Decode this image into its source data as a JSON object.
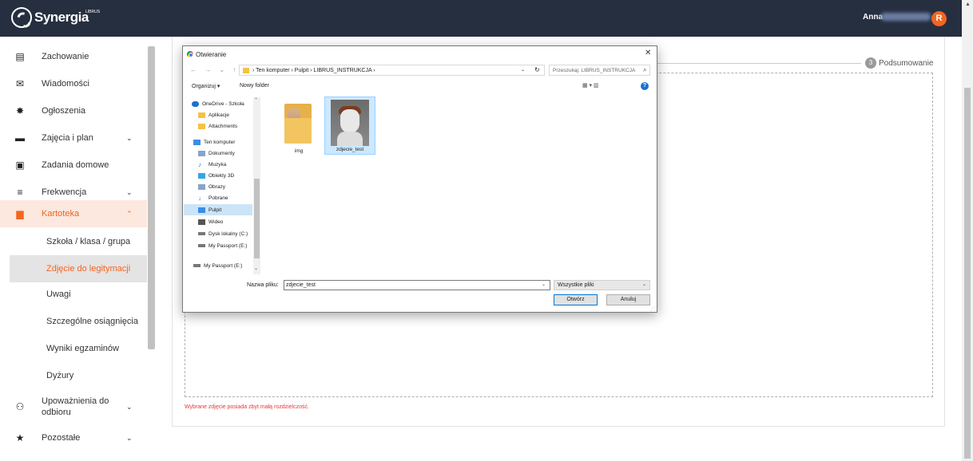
{
  "header": {
    "logo": "Synergia",
    "logo_small": "LIBRUS",
    "user_name": "Anna",
    "avatar_letter": "R"
  },
  "sidebar": {
    "items": [
      {
        "label": "Zachowanie",
        "icon": "document-icon",
        "glyph": "▤"
      },
      {
        "label": "Wiadomości",
        "icon": "mail-icon",
        "glyph": "✉"
      },
      {
        "label": "Ogłoszenia",
        "icon": "megaphone-icon",
        "glyph": "✸"
      },
      {
        "label": "Zajęcia i plan",
        "icon": "schedule-icon",
        "glyph": "▬",
        "chevron": "⌄"
      },
      {
        "label": "Zadania domowe",
        "icon": "clipboard-icon",
        "glyph": "▣"
      },
      {
        "label": "Frekwencja",
        "icon": "checklist-icon",
        "glyph": "≡",
        "chevron": "⌄"
      },
      {
        "label": "Kartoteka",
        "icon": "id-card-icon",
        "glyph": "▆",
        "chevron": "⌃"
      },
      {
        "label": "Upoważnienia do odbioru",
        "icon": "people-icon",
        "glyph": "⚇",
        "chevron": "⌄"
      },
      {
        "label": "Pozostałe",
        "icon": "star-icon",
        "glyph": "★",
        "chevron": "⌄"
      }
    ],
    "sub_items": [
      {
        "label": "Szkoła / klasa / grupa"
      },
      {
        "label": "Zdjęcie do legitymacji"
      },
      {
        "label": "Uwagi"
      },
      {
        "label": "Szczególne osiągnięcia"
      },
      {
        "label": "Wyniki egzaminów"
      },
      {
        "label": "Dyżury"
      }
    ],
    "active_color": "#f26522"
  },
  "main": {
    "step_number": "3",
    "step_label": "Podsumowanie",
    "error": "Wybrane zdjęcie posiada zbyt małą rozdzielczość."
  },
  "dialog": {
    "title": "Otwieranie",
    "close": "✕",
    "nav": "← → ⌄ ↑",
    "breadcrumb": "› Ten komputer › Pulpit › LIBRUS_INSTRUKCJA ›",
    "search_placeholder": "Przeszukaj: LIBRUS_INSTRUKCJA",
    "organize": "Organizuj ▾",
    "new_folder": "Nowy folder",
    "view_icons": "▦ ▾   ▥",
    "help": "?",
    "nav_items": [
      {
        "label": "OneDrive - Szkoła",
        "color": "#1e6fd0"
      },
      {
        "label": "Aplikacje",
        "color": "#f5c342"
      },
      {
        "label": "Attachments",
        "color": "#f5c342"
      },
      {
        "label": "Ten komputer",
        "color": "#3a8ee6"
      },
      {
        "label": "Dokumenty",
        "color": "#8aa4c8"
      },
      {
        "label": "Muzyka",
        "color": "#1e6fd0"
      },
      {
        "label": "Obiekty 3D",
        "color": "#35a7e0"
      },
      {
        "label": "Obrazy",
        "color": "#8aa4c8"
      },
      {
        "label": "Pobrane",
        "color": "#1e6fd0"
      },
      {
        "label": "Pulpit",
        "color": "#3a8ee6"
      },
      {
        "label": "Wideo",
        "color": "#555555"
      },
      {
        "label": "Dysk lokalny (C:)",
        "color": "#777777"
      },
      {
        "label": "My Passport (E:)",
        "color": "#777777"
      },
      {
        "label": "My Passport (E:)",
        "color": "#777777"
      }
    ],
    "files": [
      {
        "name": "img"
      },
      {
        "name": "zdjecie_test"
      }
    ],
    "filename_label": "Nazwa pliku:",
    "filename_value": "zdjecie_test",
    "filetype": "Wszystkie pliki",
    "open_button": "Otwórz",
    "cancel_button": "Anuluj"
  }
}
